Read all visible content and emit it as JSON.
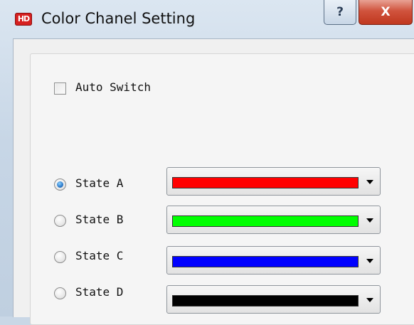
{
  "window": {
    "title": "Color Chanel Setting",
    "app_icon_text": "HD",
    "help_label": "?",
    "close_label": "X"
  },
  "auto_switch": {
    "label": "Auto Switch",
    "checked": false
  },
  "states": [
    {
      "label": "State A",
      "selected": true,
      "color": "#ff0000"
    },
    {
      "label": "State B",
      "selected": false,
      "color": "#00ff00"
    },
    {
      "label": "State C",
      "selected": false,
      "color": "#0000ff"
    },
    {
      "label": "State D",
      "selected": false,
      "color": "#000000"
    }
  ]
}
